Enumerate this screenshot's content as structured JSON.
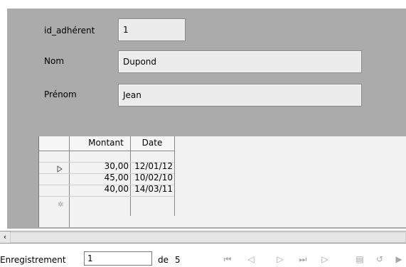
{
  "form": {
    "fields": [
      {
        "label": "id_adhérent",
        "value": "1"
      },
      {
        "label": "Nom",
        "value": "Dupond"
      },
      {
        "label": "Prénom",
        "value": "Jean"
      }
    ]
  },
  "subform": {
    "columns": [
      "Montant",
      "Date"
    ],
    "rows": [
      {
        "montant": "30,00",
        "date": "12/01/12"
      },
      {
        "montant": "45,00",
        "date": "10/02/10"
      },
      {
        "montant": "40,00",
        "date": "14/03/11"
      }
    ]
  },
  "navigation": {
    "record_label": "Enregistrement",
    "record_value": "1",
    "of_label": "de",
    "total": "5"
  }
}
